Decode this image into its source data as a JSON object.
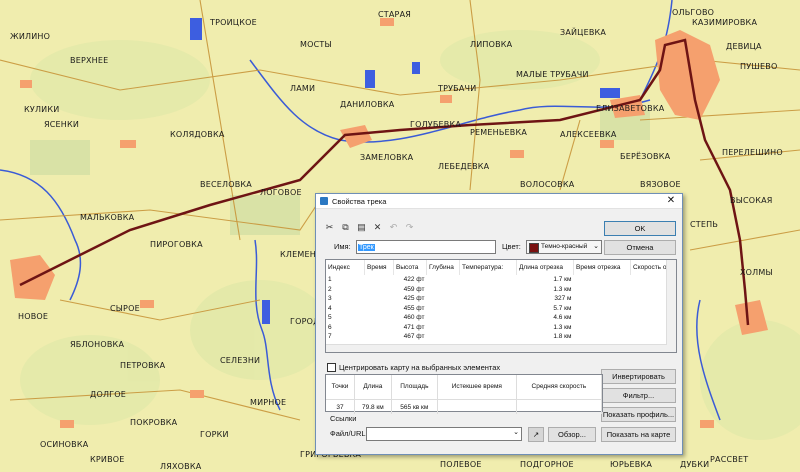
{
  "map": {
    "towns": [
      "ОЛЬГОВО",
      "КАЗИМИРОВКА",
      "ДЕВИЦА",
      "ПУШЕВО",
      "ЕЛИЗАВЕТОВКА",
      "ПЕРЕЛЕШИНО",
      "ВЫСОКАЯ",
      "МАЛЫЕ ТРУБАЧИ",
      "АЛЕКСЕЕВКА",
      "РЕМЕНЬЕВКА",
      "ВЯЗОВОЕ",
      "ГОЛУБЕВКА",
      "ЛЕБЕДЕВКА",
      "КОЛЯДОВКА",
      "ТРУБАЧИ",
      "ЯСЕНКИ",
      "ЗАМЕЛОВКА",
      "КЛЕМЕНТЬЕВКА",
      "ГОРОДЕЦ",
      "ВЕСЕЛОВКА",
      "ЛАМИ",
      "СТАРАЯ",
      "ВОЛОСОВКА",
      "ЛОГОВОЕ",
      "СЫРОЕ",
      "НОВОЕ",
      "ЯБЛОНОВКА",
      "ПЕТРОВКА",
      "МАЛЬКОВКА",
      "ПИРОГОВКА",
      "ДОЛГОЕ",
      "ПОКРОВКА",
      "ГОРКИ",
      "КРИВОЕ",
      "МИРНОЕ",
      "СЕЛЕЗНИ",
      "ЖИЛИНО",
      "КУЛИКИ",
      "ВЕРХНЕЕ",
      "ТРОИЦКОЕ",
      "МОСТЫ",
      "ДАНИЛОВКА",
      "ЛИПОВКА",
      "ЗАЙЦЕВКА",
      "БЕРЁЗОВКА",
      "СТЕПЬ",
      "ХОЛМЫ",
      "ДУБКИ",
      "РАССВЕТ",
      "ЮРЬЕВКА",
      "ПОДГОРНОЕ",
      "ПОЛЕВОЕ",
      "ГРИГОРЬЕВКА",
      "ЛЯХОВКА",
      "ОСИНОВКА"
    ]
  },
  "dialog": {
    "title": "Свойства трека",
    "close": "✕",
    "toolbar": [
      "✂",
      "⧉",
      "▤",
      "✕",
      "↶",
      "↷"
    ],
    "name_label": "Имя:",
    "name_value": "Трек",
    "color_label": "Цвет:",
    "color_value": "Темно-красный",
    "color_hex": "#7a1010",
    "ok_label": "OK",
    "cancel_label": "Отмена",
    "columns": [
      "Индекс",
      "Время",
      "Высота",
      "Глубина",
      "Температура:",
      "Длина отрезка",
      "Время отрезка",
      "Скорость от"
    ],
    "rows": [
      {
        "idx": "1",
        "alt": "422 фт",
        "len": "1.7 км"
      },
      {
        "idx": "2",
        "alt": "459 фт",
        "len": "1.3 км"
      },
      {
        "idx": "3",
        "alt": "425 фт",
        "len": "327 м"
      },
      {
        "idx": "4",
        "alt": "455 фт",
        "len": "5.7 км"
      },
      {
        "idx": "5",
        "alt": "460 фт",
        "len": "4.6 км"
      },
      {
        "idx": "6",
        "alt": "471 фт",
        "len": "1.3 км"
      },
      {
        "idx": "7",
        "alt": "467 фт",
        "len": "1.8 км"
      }
    ],
    "center_label": "Центрировать карту на выбранных элементах",
    "invert_label": "Инвертировать",
    "filter_label": "Фильтр...",
    "profile_label": "Показать профиль...",
    "showmap_label": "Показать на карте",
    "stats_headers": [
      "Точки",
      "Длина",
      "Площадь",
      "Истекшее время",
      "Средняя скорость"
    ],
    "stats_values": [
      "37",
      "79.8 км",
      "565 кв км",
      "",
      ""
    ],
    "links_label": "Ссылки",
    "file_label": "Файл/URL:",
    "browse_label": "Обзор..."
  }
}
